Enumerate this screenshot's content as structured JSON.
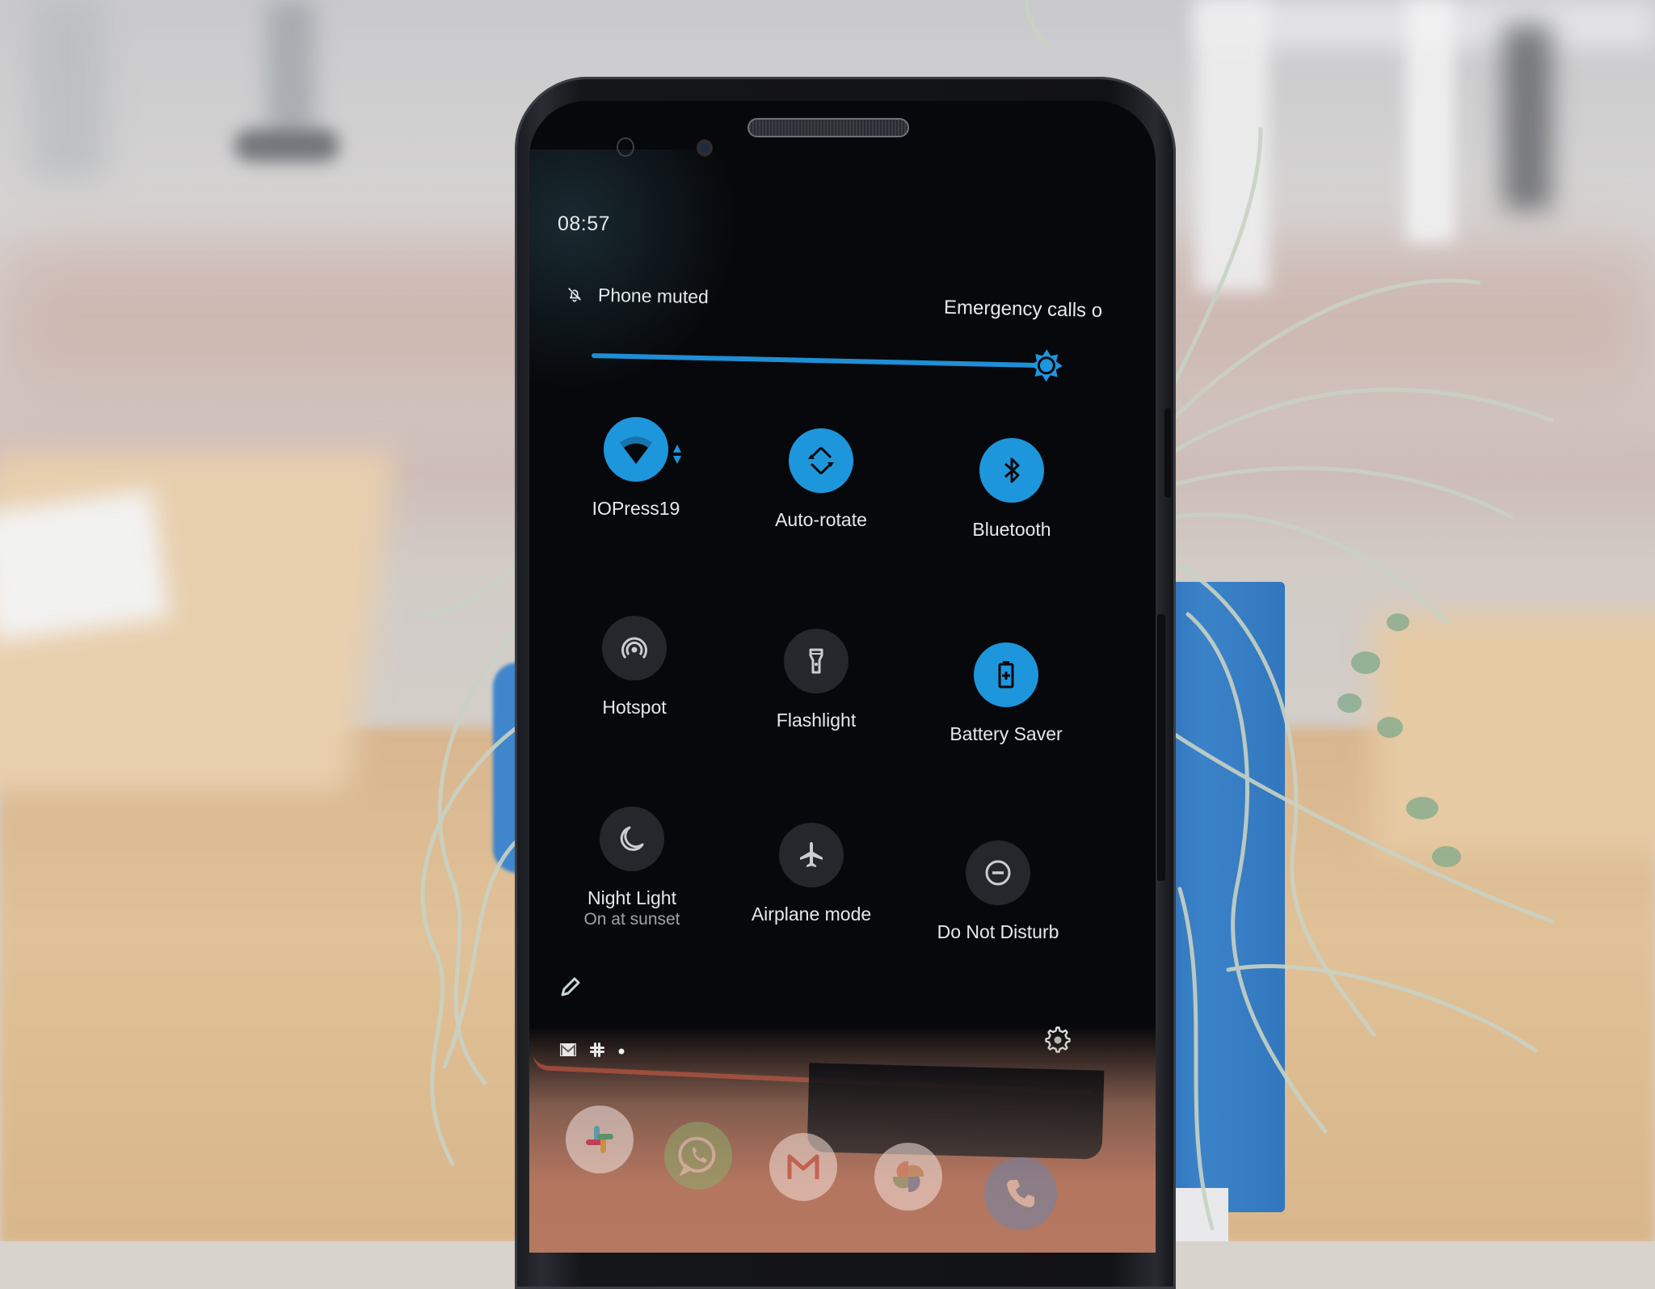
{
  "status_bar": {
    "time": "08:57"
  },
  "header": {
    "ringer_status": "Phone muted",
    "ringer_icon": "bell-off-icon",
    "carrier_status": "Emergency calls o"
  },
  "brightness": {
    "level_percent": 97,
    "icon": "brightness-icon"
  },
  "tiles": [
    {
      "id": "wifi",
      "label": "IOPress19",
      "icon": "wifi-icon",
      "active": true,
      "signal_bars": 3,
      "signal_max": 4,
      "has_activity": true
    },
    {
      "id": "auto-rotate",
      "label": "Auto-rotate",
      "icon": "rotate-icon",
      "active": true
    },
    {
      "id": "bluetooth",
      "label": "Bluetooth",
      "icon": "bluetooth-icon",
      "active": true
    },
    {
      "id": "hotspot",
      "label": "Hotspot",
      "icon": "hotspot-icon",
      "active": false
    },
    {
      "id": "flashlight",
      "label": "Flashlight",
      "icon": "flashlight-icon",
      "active": false
    },
    {
      "id": "battery-saver",
      "label": "Battery Saver",
      "icon": "battery-saver-icon",
      "active": true
    },
    {
      "id": "night-light",
      "label": "Night Light",
      "sublabel": "On at sunset",
      "icon": "moon-icon",
      "active": false
    },
    {
      "id": "airplane",
      "label": "Airplane mode",
      "icon": "airplane-icon",
      "active": false
    },
    {
      "id": "dnd",
      "label": "Do Not Disturb",
      "icon": "dnd-icon",
      "active": false
    }
  ],
  "footer": {
    "edit_icon": "pencil-icon",
    "settings_icon": "gear-icon"
  },
  "notification_icons": [
    "gmail-icon",
    "slack-icon",
    "more-dot-icon"
  ],
  "dock_apps": [
    {
      "name": "Slack",
      "icon": "slack-icon"
    },
    {
      "name": "WhatsApp",
      "icon": "whatsapp-icon"
    },
    {
      "name": "Gmail",
      "icon": "gmail-icon"
    },
    {
      "name": "Photos",
      "icon": "photos-icon"
    },
    {
      "name": "Phone",
      "icon": "phone-icon"
    }
  ],
  "colors": {
    "accent": "#1e96dc",
    "tile_off": "#24272c",
    "text": "#e6e9ec",
    "subtext": "#9ea3a8",
    "panel": "#07080b"
  }
}
